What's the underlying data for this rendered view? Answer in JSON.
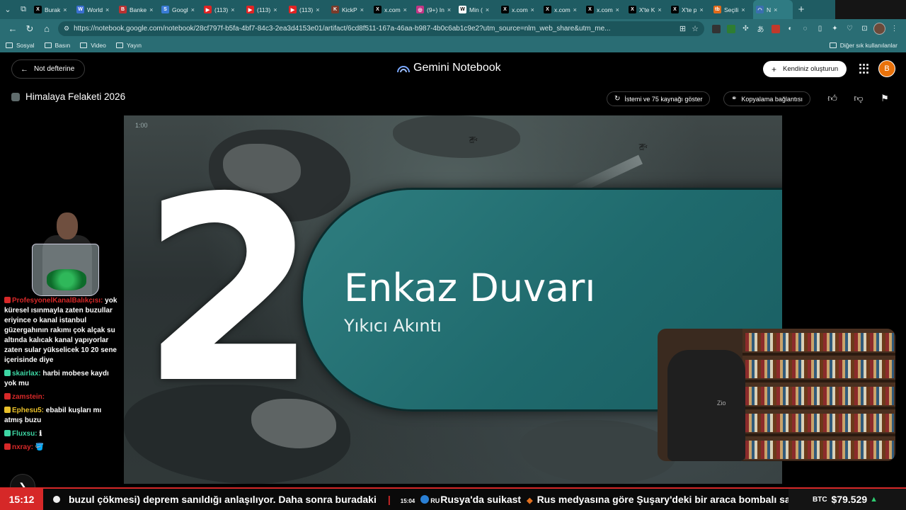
{
  "browser": {
    "tabs": [
      {
        "title": "Burak",
        "fav": "X",
        "color": "#000000"
      },
      {
        "title": "World",
        "fav": "W",
        "color": "#3b6fd1"
      },
      {
        "title": "Banke",
        "fav": "B",
        "color": "#b83232"
      },
      {
        "title": "Googl",
        "fav": "S",
        "color": "#3a7bd5"
      },
      {
        "title": "(113)",
        "fav": "▶",
        "color": "#e02424"
      },
      {
        "title": "(113)",
        "fav": "▶",
        "color": "#e02424"
      },
      {
        "title": "(113)",
        "fav": "▶",
        "color": "#e02424"
      },
      {
        "title": "KickP",
        "fav": "K",
        "color": "#7a3b2a"
      },
      {
        "title": "x.com",
        "fav": "X",
        "color": "#000000"
      },
      {
        "title": "(9+) In",
        "fav": "◎",
        "color": "#c13584"
      },
      {
        "title": "Min (",
        "fav": "W",
        "color": "#ffffff"
      },
      {
        "title": "x.com",
        "fav": "X",
        "color": "#000000"
      },
      {
        "title": "x.com",
        "fav": "X",
        "color": "#000000"
      },
      {
        "title": "x.com",
        "fav": "X",
        "color": "#000000"
      },
      {
        "title": "X'te K",
        "fav": "X",
        "color": "#000000"
      },
      {
        "title": "X'te p",
        "fav": "X",
        "color": "#000000"
      },
      {
        "title": "Seçili",
        "fav": "tb",
        "color": "#e06a1a"
      },
      {
        "title": "N",
        "fav": "◠",
        "color": "#3a6fb0"
      }
    ],
    "url": "https://notebook.google.com/notebook/28cf797f-b5fa-4bf7-84c3-2ea3d4153e01/artifact/6cd8f511-167a-46aa-b987-4b0c6ab1c9e2?utm_source=nlm_web_share&utm_me...",
    "bookmarks": [
      "Sosyal",
      "Basın",
      "Video",
      "Yayın"
    ],
    "bookmarks_other": "Diğer sık kullanılanlar"
  },
  "app": {
    "back_label": "Not defterine",
    "brand": "Gemini Notebook",
    "create_label": "Kendiniz oluşturun",
    "avatar_letter": "B",
    "notebook_title": "Himalaya Felaketi 2026",
    "show_sources_label": "İstemi ve 75 kaynağı göster",
    "copy_link_label": "Kopyalama bağlantısı"
  },
  "slide": {
    "time": "1:00",
    "number": "2",
    "title": "Enkaz Duvarı",
    "subtitle": "Yıkıcı Akıntı"
  },
  "chat": [
    {
      "user": "ProfesyonelKanalBalıkçısı:",
      "text": "yok küresel ısınmayla zaten buzullar eriyince o kanal istanbul güzergahının rakımı çok alçak su altında kalıcak kanal yapıyorlar zaten sular yükselicek 10 20 sene içerisinde diye",
      "color": "#d62828"
    },
    {
      "user": "skairlax:",
      "text": "harbi mobese kaydı yok mu",
      "color": "#3dd6a3"
    },
    {
      "user": "zamstein:",
      "text": "",
      "color": "#d62828"
    },
    {
      "user": "Ephesu5:",
      "text": "ebabil kuşları mı atmış buzu",
      "color": "#e8c02a"
    },
    {
      "user": "Fluxsu:",
      "text": "ℹ",
      "color": "#3dd6a3"
    },
    {
      "user": "nxray:",
      "text": "🪣",
      "color": "#d62828"
    }
  ],
  "ticker": {
    "clock": "15:12",
    "headline_1": "buzul çökmesi) deprem sanıldığı anlaşılıyor. Daha sonra buradaki",
    "time_2": "15:04",
    "flag_code": "RU",
    "headline_2": "Rusya'da suikast",
    "headline_3": "Rus medyasına göre Şuşary'deki bir araca bombalı sald",
    "btc_label": "BTC",
    "btc_value": "$79.529"
  }
}
